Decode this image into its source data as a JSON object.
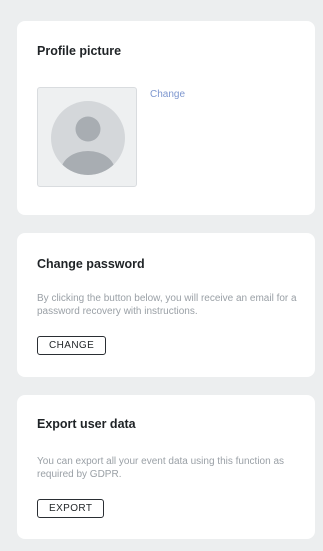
{
  "profile_card": {
    "title": "Profile picture",
    "change_link": "Change"
  },
  "password_card": {
    "title": "Change password",
    "description": "By clicking the button below, you will receive an email for a password recovery with instructions.",
    "button_label": "CHANGE"
  },
  "export_card": {
    "title": "Export user data",
    "description": "You can export all your event data using this function as required by GDPR.",
    "button_label": "EXPORT"
  },
  "colors": {
    "page_background": "#eceeef",
    "card_background": "#ffffff",
    "link": "#7e97cf",
    "muted_text": "#9aa0a6"
  },
  "icons": {
    "avatar": "user-avatar-placeholder-icon"
  }
}
